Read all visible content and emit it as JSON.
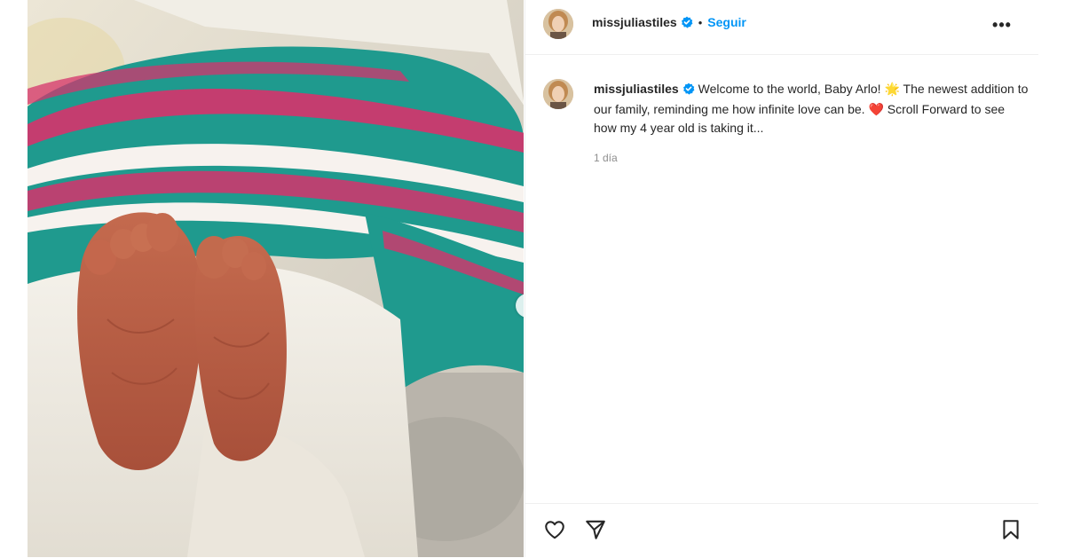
{
  "post": {
    "username": "missjuliastiles",
    "follow_label": "Seguir",
    "separator": "•",
    "more_label": "•••",
    "caption_text": "Welcome to the world, Baby Arlo! 🌟 The newest addition to our family, reminding me how infinite love can be. ❤️ Scroll Forward to see how my 4 year old is taking it...",
    "timestamp": "1 día"
  },
  "colors": {
    "link": "#0095f6",
    "verified": "#0095f6",
    "text": "#262626",
    "muted": "#8e8e8e",
    "blanket_teal": "#1f9a8e",
    "blanket_pink": "#d6336c"
  },
  "icons": {
    "verified": "verified-badge-icon",
    "like": "heart-icon",
    "share": "paper-plane-icon",
    "save": "bookmark-icon",
    "next": "chevron-right-icon",
    "more": "ellipsis-icon"
  }
}
